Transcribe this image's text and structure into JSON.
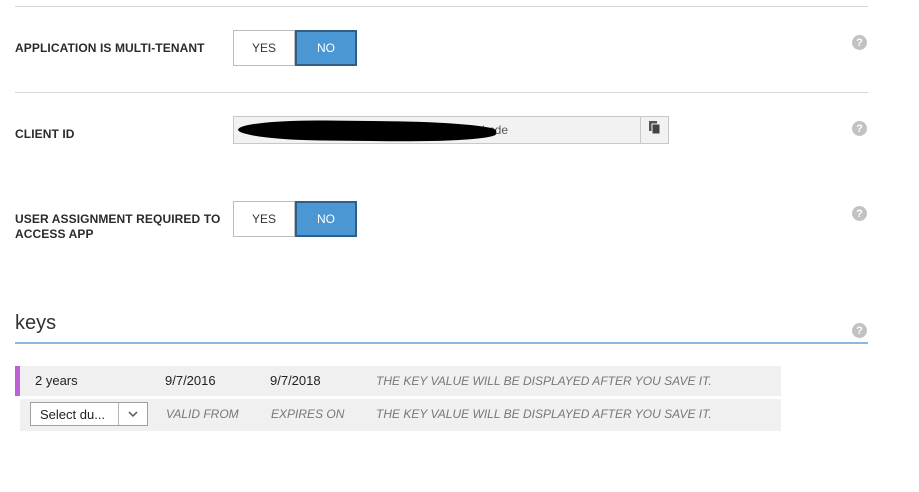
{
  "settings": {
    "multi_tenant": {
      "label": "APPLICATION IS MULTI-TENANT",
      "yes": "YES",
      "no": "NO",
      "selected": "NO",
      "help": "?"
    },
    "client_id": {
      "label": "CLIENT ID",
      "value_visible_tail": "...bcde",
      "copy_icon": "copy-icon",
      "help": "?"
    },
    "user_assignment": {
      "label_line1": "USER ASSIGNMENT REQUIRED TO",
      "label_line2": "ACCESS APP",
      "yes": "YES",
      "no": "NO",
      "selected": "NO",
      "help": "?"
    }
  },
  "keys": {
    "title": "keys",
    "help": "?",
    "rows": [
      {
        "duration": "2 years",
        "valid_from": "9/7/2016",
        "expires_on": "9/7/2018",
        "value": "THE KEY VALUE WILL BE DISPLAYED AFTER YOU SAVE IT."
      }
    ],
    "new_row": {
      "select_value": "Select du...",
      "valid_from": "VALID FROM",
      "expires_on": "EXPIRES ON",
      "value": "THE KEY VALUE WILL BE DISPLAYED AFTER YOU SAVE IT."
    }
  },
  "colors": {
    "toggle_selected": "#4a97d4",
    "keys_underline": "#8ab8de",
    "row_accent": "#c15fd9"
  }
}
